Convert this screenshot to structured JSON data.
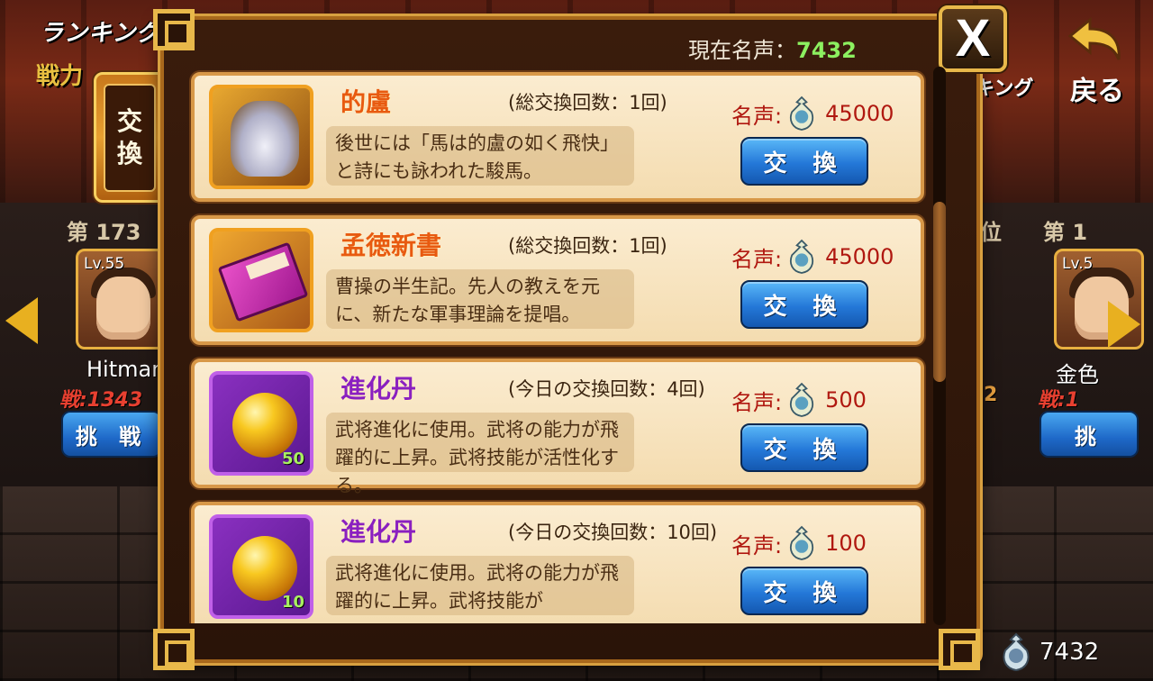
{
  "background": {
    "ranking_label": "ランキング",
    "power_label": "戦力",
    "side_tab_label_1": "交",
    "side_tab_label_2": "換",
    "rank_left": "第 173",
    "rank_right_pos": "位",
    "rank_right": "第 1",
    "hero_left_level": "Lv.55",
    "hero_right_level": "Lv.5",
    "hero_left_name": "Hitman",
    "hero_right_name": "金色",
    "hero_left_power": "戦:1343",
    "hero_right_power": "戦:1",
    "hero_right_power_digit": "2",
    "challenge_left_label": "挑 戦",
    "challenge_right_label": "挑",
    "return_label": "戻る",
    "king_label": "キング",
    "bottom_currency": "7432"
  },
  "modal": {
    "fame_label": "現在名声：",
    "fame_value": "7432",
    "close_label": "X",
    "price_label": "名声:",
    "exchange_label": "交 換",
    "items": [
      {
        "name": "的盧",
        "name_color": "orange",
        "count_text": "(総交換回数：1回)",
        "desc": "後世には「馬は的盧の如く飛快」と詩にも詠われた駿馬。",
        "price": "45000",
        "icon": "horse-icon",
        "stack": ""
      },
      {
        "name": "孟徳新書",
        "name_color": "orange",
        "count_text": "(総交換回数：1回)",
        "desc": "曹操の半生記。先人の教えを元に、新たな軍事理論を提唱。",
        "price": "45000",
        "icon": "book-icon",
        "stack": ""
      },
      {
        "name": "進化丹",
        "name_color": "purple",
        "count_text": "(今日の交換回数：4回)",
        "desc": "武将進化に使用。武将の能力が飛躍的に上昇。武将技能が活性化する。",
        "price": "500",
        "icon": "orb-icon",
        "stack": "50"
      },
      {
        "name": "進化丹",
        "name_color": "purple",
        "count_text": "(今日の交換回数：10回)",
        "desc": "武将進化に使用。武将の能力が飛躍的に上昇。武将技能が",
        "price": "100",
        "icon": "orb-icon",
        "stack": "10"
      }
    ]
  },
  "colors": {
    "fame_value": "#8cf060",
    "price": "#b01810",
    "button_blue": "#2478d8",
    "frame_gold": "#e8b84a"
  }
}
